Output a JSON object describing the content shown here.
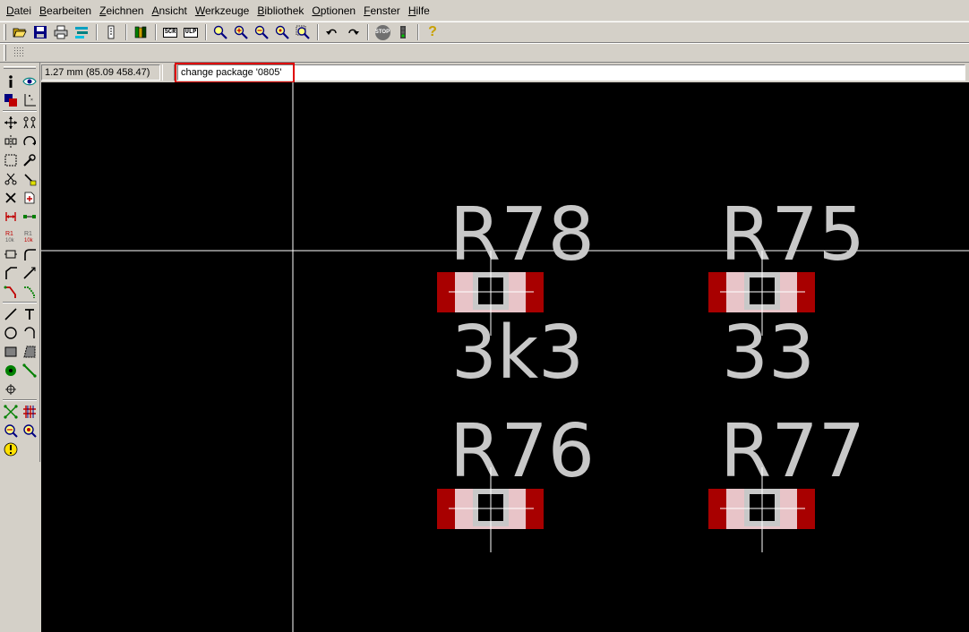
{
  "menu": [
    {
      "label": "Datei",
      "name": "menu-datei"
    },
    {
      "label": "Bearbeiten",
      "name": "menu-bearbeiten"
    },
    {
      "label": "Zeichnen",
      "name": "menu-zeichnen"
    },
    {
      "label": "Ansicht",
      "name": "menu-ansicht"
    },
    {
      "label": "Werkzeuge",
      "name": "menu-werkzeuge"
    },
    {
      "label": "Bibliothek",
      "name": "menu-bibliothek"
    },
    {
      "label": "Optionen",
      "name": "menu-optionen"
    },
    {
      "label": "Fenster",
      "name": "menu-fenster"
    },
    {
      "label": "Hilfe",
      "name": "menu-hilfe"
    }
  ],
  "toolbar": {
    "scr_label": "SCR",
    "ulp_label": "ULP",
    "stop_label": "STOP",
    "help_label": "?"
  },
  "cmdbar": {
    "coordinates": "1.27 mm (85.09 458.47)",
    "command": "change package '0805'"
  },
  "canvas": {
    "parts": [
      {
        "name": "R78",
        "value": "3k3"
      },
      {
        "name": "R75",
        "value": "33"
      },
      {
        "name": "R76",
        "value": ""
      },
      {
        "name": "R77",
        "value": ""
      }
    ]
  },
  "colors": {
    "canvas_bg": "#000000",
    "pad_red": "#a80000",
    "pad_pink": "#e8c4c8",
    "label_gray": "#c8c8c8",
    "highlight": "#e00000"
  }
}
